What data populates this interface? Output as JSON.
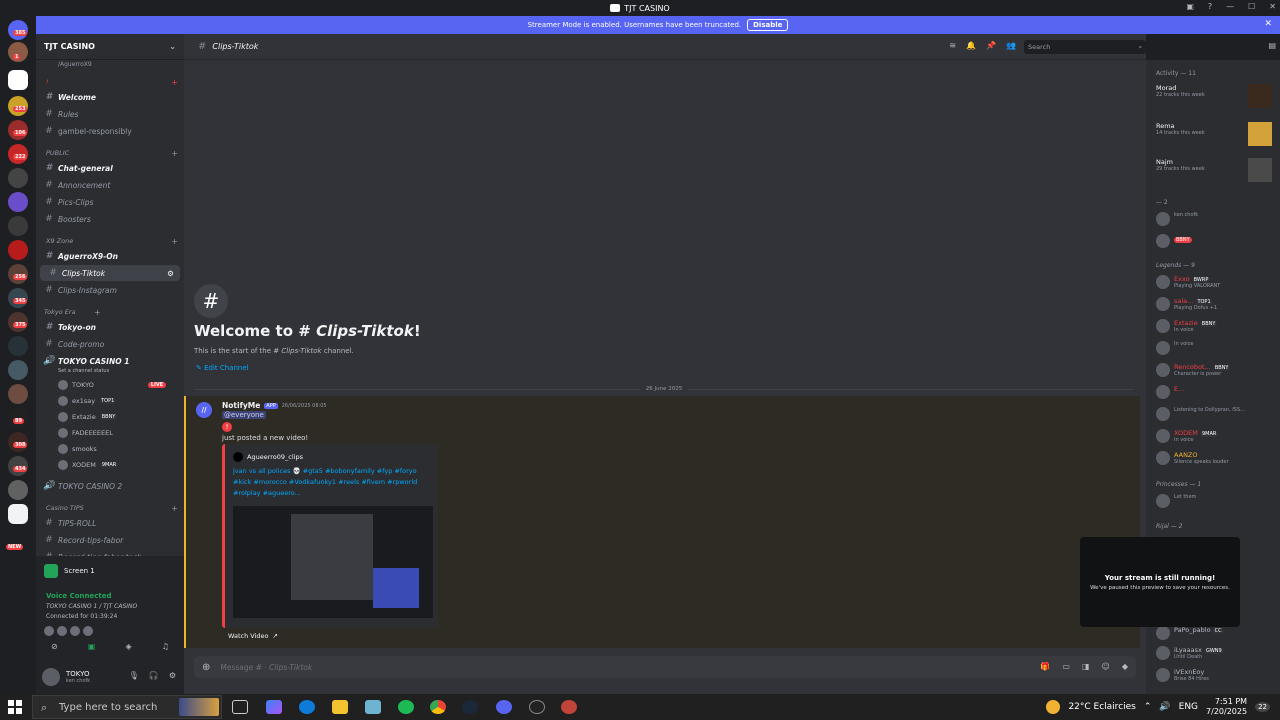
{
  "app": {
    "title": "TJT CASINO"
  },
  "banner": {
    "text": "Streamer Mode is enabled. Usernames have been truncated.",
    "button": "Disable"
  },
  "rail_badges": [
    "385",
    "1",
    "253",
    "106",
    "222",
    "256",
    "345",
    "375",
    "89",
    "308",
    "434",
    "NEW"
  ],
  "server": {
    "name": "TJT CASINO",
    "top_hint": "/AguerroX9"
  },
  "sidebar": {
    "uncat_label": "!",
    "ch_welcome": "Welcome",
    "ch_rules": "Rules",
    "ch_gambel": "gambel-responsibly",
    "cat_public": "PUBLIC",
    "ch_chat": "Chat-general",
    "ch_annonce": "Annoncement",
    "ch_pics": "Pics-Clips",
    "ch_boosters": "Boosters",
    "cat_x9": "X9 Zone",
    "ch_aguerro": "AguerroX9-On",
    "ch_clips": "Clips-Tiktok",
    "ch_insta": "Clips-Instagram",
    "cat_tokyo": "Tokyo Era",
    "ch_tokyoon": "Tokyo-on",
    "ch_code": "Code-promo",
    "ch_voice1": "TOKYO CASINO 1",
    "voice_status": "Set a channel status",
    "voice_users": [
      {
        "name": "TOKYO",
        "tag": "LIVE"
      },
      {
        "name": "ex1say",
        "tag": "TOP1"
      },
      {
        "name": "Extazie",
        "tag": "BBNY"
      },
      {
        "name": "FADEEEEEEL",
        "tag": ""
      },
      {
        "name": "smooks",
        "tag": ""
      },
      {
        "name": "XODEM",
        "tag": "9MAR"
      }
    ],
    "ch_voice2": "TOKYO CASINO 2",
    "cat_tips": "Casino TIPS",
    "ch_tips": "TIPS-ROLL",
    "ch_record1": "Record-tips-fabor",
    "ch_record2": "Record-tips-fabor-tech"
  },
  "voice_panel": {
    "screen": "Screen 1",
    "connected": "Voice Connected",
    "location": "TOKYO CASINO 1 / TJT CASINO",
    "time": "Connected for 01:39:24"
  },
  "user": {
    "name": "TOKYO",
    "status": "ken chofk"
  },
  "chat": {
    "channel": "Clips-Tiktok",
    "search_placeholder": "Search",
    "welcome_prefix": "Welcome to #",
    "welcome_channel": "Clips-Tiktok",
    "welcome_suffix": "!",
    "start_prefix": "This is the start of the #",
    "start_channel": "Clips-Tiktok",
    "start_suffix": "channel.",
    "edit_channel": "Edit Channel",
    "date": "26 June 2025",
    "composer_placeholder": "Message #",
    "composer_channel": "Clips-Tiktok"
  },
  "message": {
    "author": "NotifyMe",
    "app_tag": "APP",
    "timestamp": "26/06/2025 08:05",
    "mention": "@everyone",
    "text": "just posted a new video!",
    "embed_author": "Agueerro09_clips",
    "embed_desc": "jvan vs all polices 💀 #gta5 #bobonyfamily #fyp #foryo #kick #morocco #Vodkafunky1 #reels #fivem #rpworld #rolplay #agueero...",
    "watch": "Watch Video"
  },
  "members": {
    "activity_header": "Activity — 11",
    "activity": [
      {
        "name": "Morad",
        "sub": "22 tracks this week"
      },
      {
        "name": "Rema",
        "sub": "14 tracks this week"
      },
      {
        "name": "Najm",
        "sub": "29 tracks this week"
      }
    ],
    "group1": "— 2",
    "g1": [
      {
        "name": "",
        "sub": "ken chofk"
      },
      {
        "name": "",
        "sub": ""
      }
    ],
    "legends_header": "Legends — 9",
    "legends": [
      {
        "name": "Exxo",
        "tag": "BWRP",
        "sub": "Playing VALORANT"
      },
      {
        "name": "sala...",
        "tag": "TOP1",
        "sub": "Playing Dofus +1"
      },
      {
        "name": "Extazie",
        "tag": "BBNY",
        "sub": "In voice"
      },
      {
        "name": "",
        "tag": "",
        "sub": "In voice"
      },
      {
        "name": "Rencobot...",
        "tag": "BBNY",
        "sub": "Character is power"
      },
      {
        "name": "E...",
        "tag": "",
        "sub": ""
      },
      {
        "name": "",
        "tag": "",
        "sub": "Listening to Dollypran, ISS..."
      },
      {
        "name": "XODEM",
        "tag": "9MAR",
        "sub": "In voice"
      },
      {
        "name": "AANZO",
        "tag": "",
        "sub": "Silence speaks louder"
      }
    ],
    "princesses_header": "Princesses — 1",
    "princess": {
      "name": "",
      "sub": "Let them"
    },
    "rijal_header": "Rijal — 2",
    "bottom": [
      {
        "name": "PaPo_pablo",
        "tag": "CC",
        "sub": ""
      },
      {
        "name": "iLyaaasx",
        "tag": "GWN9",
        "sub": "Until Death"
      },
      {
        "name": "iVExnEoy",
        "tag": "",
        "sub": "Brise 84 Hires"
      }
    ]
  },
  "popup": {
    "title": "Your stream is still running!",
    "sub": "We've paused this preview to save your resources."
  },
  "taskbar": {
    "search": "Type here to search",
    "weather": "22°C Eclaircies",
    "time": "7:51 PM",
    "date": "7/20/2025",
    "notif": "22"
  }
}
